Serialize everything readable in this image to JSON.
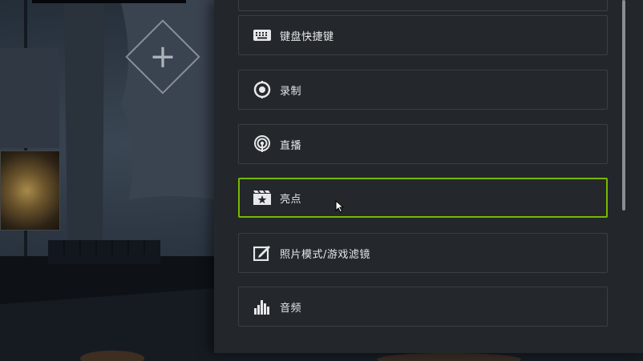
{
  "menu": {
    "items": [
      {
        "label": "",
        "icon": "partial-item"
      },
      {
        "label": "键盘快捷键",
        "icon": "keyboard-icon"
      },
      {
        "label": "录制",
        "icon": "record-icon"
      },
      {
        "label": "直播",
        "icon": "broadcast-icon"
      },
      {
        "label": "亮点",
        "icon": "highlights-icon",
        "selected": true
      },
      {
        "label": "照片模式/游戏滤镜",
        "icon": "photo-mode-icon"
      },
      {
        "label": "音频",
        "icon": "audio-icon"
      }
    ]
  },
  "colors": {
    "selected_border": "#76b900",
    "panel_bg": "#23272b",
    "item_border": "#3a3f44",
    "label_text": "#e6e8ea"
  },
  "add_widget": {
    "icon": "plus-icon"
  }
}
